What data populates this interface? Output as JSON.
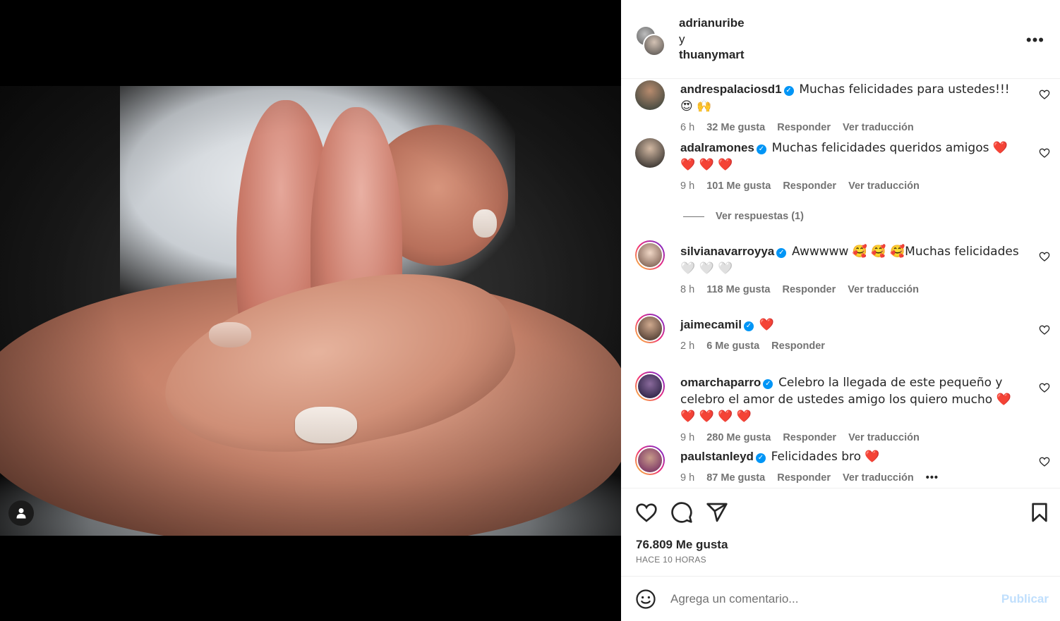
{
  "header": {
    "owner_1": "adrianuribe",
    "separator": "y",
    "owner_2": "thuanymart",
    "more_label": "•••"
  },
  "comments": [
    {
      "user": "andrespalaciosd1",
      "text": "Muchas felicidades para ustedes!!! 😍 🙌",
      "time": "6 h",
      "likes": "32 Me gusta",
      "reply": "Responder",
      "translate": "Ver traducción"
    },
    {
      "user": "adalramones",
      "text": "Muchas felicidades queridos amigos ❤️ ❤️ ❤️ ❤️",
      "time": "9 h",
      "likes": "101 Me gusta",
      "reply": "Responder",
      "translate": "Ver traducción",
      "replies_label": "Ver respuestas (1)"
    },
    {
      "user": "silvianavarroyya",
      "text": "Awwwww 🥰 🥰 🥰Muchas felicidades 🤍 🤍 🤍",
      "time": "8 h",
      "likes": "118 Me gusta",
      "reply": "Responder",
      "translate": "Ver traducción"
    },
    {
      "user": "jaimecamil",
      "text": "❤️",
      "time": "2 h",
      "likes": "6 Me gusta",
      "reply": "Responder"
    },
    {
      "user": "omarchaparro",
      "text": "Celebro la llegada de este pequeño y celebro el amor de ustedes amigo los quiero mucho ❤️ ❤️ ❤️ ❤️ ❤️",
      "time": "9 h",
      "likes": "280 Me gusta",
      "reply": "Responder",
      "translate": "Ver traducción"
    },
    {
      "user": "paulstanleyd",
      "text": "Felicidades bro ❤️",
      "time": "9 h",
      "likes": "87 Me gusta",
      "reply": "Responder",
      "translate": "Ver traducción",
      "more": "•••"
    }
  ],
  "actions": {
    "like_icon": "heart-icon",
    "comment_icon": "comment-icon",
    "share_icon": "share-icon",
    "save_icon": "bookmark-icon"
  },
  "stats": {
    "likes": "76.809 Me gusta",
    "posted": "HACE 10 HORAS"
  },
  "composer": {
    "placeholder": "Agrega un comentario...",
    "publish_label": "Publicar"
  },
  "colors": {
    "verified": "#0095f6",
    "publish_disabled": "#c0dffd",
    "heart_red": "#ed1c3a"
  }
}
